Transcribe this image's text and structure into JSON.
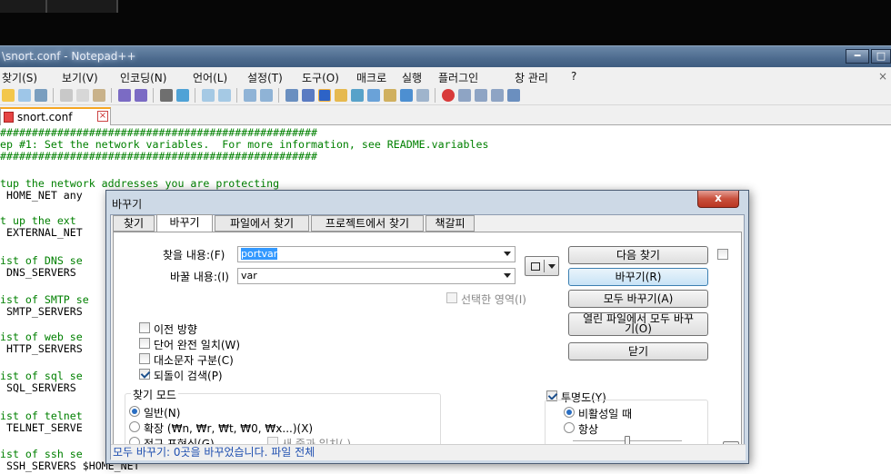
{
  "window": {
    "title": "\\snort.conf - Notepad++",
    "min_label": "━",
    "max_label": "□"
  },
  "menu": {
    "items": [
      "찾기(S)",
      "보기(V)",
      "인코딩(N)",
      "언어(L)",
      "설정(T)",
      "도구(O)",
      "매크로",
      "실행",
      "플러그인",
      "창 관리",
      "?"
    ],
    "close_label": "×"
  },
  "tab": {
    "name": "snort.conf",
    "close": "×"
  },
  "editor": {
    "lines": [
      "##################################################",
      "ep #1: Set the network variables.  For more information, see README.variables",
      "##################################################",
      "",
      "tup the network addresses you are protecting",
      " HOME_NET any",
      "",
      "t up the ext",
      " EXTERNAL_NET",
      "",
      "ist of DNS se",
      " DNS_SERVERS",
      "",
      "ist of SMTP se",
      " SMTP_SERVERS",
      "",
      "ist of web se",
      " HTTP_SERVERS",
      "",
      "ist of sql se",
      " SQL_SERVERS",
      "",
      "ist of telnet",
      " TELNET_SERVE",
      "",
      "ist of ssh se",
      " SSH_SERVERS $HOME_NET"
    ]
  },
  "dialog": {
    "title": "바꾸기",
    "close": "x",
    "tabs": [
      "찾기",
      "바꾸기",
      "파일에서 찾기",
      "프로젝트에서 찾기",
      "책갈피"
    ],
    "find_label": "찾을 내용:(F)",
    "find_value": "portvar",
    "replace_label": "바꿀 내용:(I)",
    "replace_value": "var",
    "in_selection": "선택한 영역(I)",
    "buttons": {
      "find_next": "다음 찾기",
      "replace": "바꾸기(R)",
      "replace_all": "모두 바꾸기(A)",
      "replace_all_open_1": "열린 파일에서 모두 바꾸",
      "replace_all_open_2": "기(O)",
      "close": "닫기"
    },
    "options": [
      {
        "label": "이전 방향",
        "checked": false
      },
      {
        "label": "단어 완전 일치(W)",
        "checked": false
      },
      {
        "label": "대소문자 구분(C)",
        "checked": false
      },
      {
        "label": "되돌이 검색(P)",
        "checked": true
      }
    ],
    "search_mode": {
      "label": "찾기 모드",
      "normal": "일반(N)",
      "extended": "확장 (₩n, ₩r, ₩t, ₩0, ₩x...)(X)",
      "regex": "정규 표현식(G)",
      "dot_newline": "새 줄과 일치(.)",
      "selected": "normal"
    },
    "transparency": {
      "label": "투명도(Y)",
      "checked": true,
      "on_lose_focus": "비활성일 때",
      "always": "항상",
      "selected": "on_lose_focus",
      "level": 0.5
    },
    "status": "모두 바꾸기: 0곳을 바꾸었습니다. 파일 전체"
  }
}
